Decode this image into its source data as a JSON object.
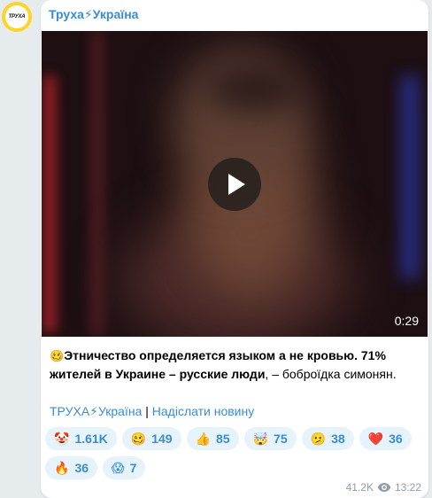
{
  "channel": {
    "name": "Труха⚡Україна",
    "avatar_text": "ТРУХА"
  },
  "video": {
    "duration": "0:29"
  },
  "message": {
    "emoji": "🥴",
    "bold_text": "Этничество определяется языком а не кровью. 71% жителей в Украине – русские люди",
    "tail_text": ", – боброїдка симонян."
  },
  "links": {
    "channel_link": "ТРУХА⚡Україна",
    "separator": " | ",
    "submit_link": "Надіслати новину"
  },
  "reactions": [
    {
      "emoji": "🤡",
      "count": "1.61K"
    },
    {
      "emoji": "🥴",
      "count": "149"
    },
    {
      "emoji": "👍",
      "count": "85"
    },
    {
      "emoji": "🤯",
      "count": "75"
    },
    {
      "emoji": "🫤",
      "count": "38"
    },
    {
      "emoji": "❤️",
      "count": "36"
    },
    {
      "emoji": "🔥",
      "count": "36"
    },
    {
      "emoji": "😱",
      "count": "7"
    }
  ],
  "meta": {
    "views": "41.2K",
    "time": "13:22"
  },
  "colors": {
    "accent": "#3a8ccf",
    "chip_bg": "#e7f3fb",
    "background": "#e6ebee",
    "avatar_ring": "#ffd426"
  }
}
